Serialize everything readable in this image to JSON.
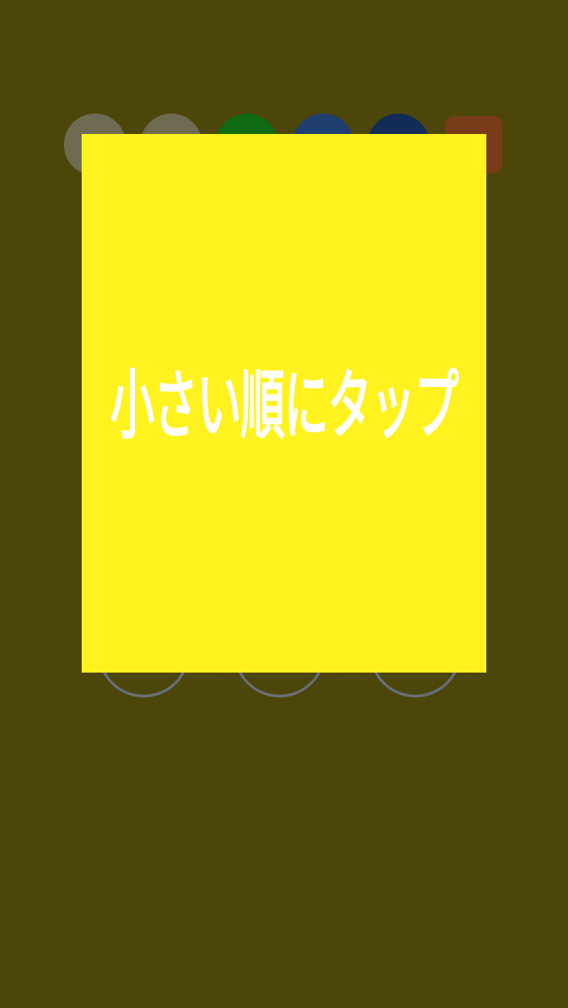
{
  "overlay": {
    "instruction": "小さい順にタップ"
  },
  "colors": {
    "background": "#4c460b",
    "overlay": "#fff21e",
    "instruction_text": "#ffffff",
    "circle_border": "#6b6e78"
  },
  "share_icons": [
    {
      "name": "mail-icon",
      "color": "#6e6b52"
    },
    {
      "name": "contact-icon",
      "color": "#6e6b52"
    },
    {
      "name": "line-icon",
      "color": "#0f6a12"
    },
    {
      "name": "facebook-icon",
      "color": "#1f3f6e"
    },
    {
      "name": "twitter-icon",
      "color": "#132c57"
    },
    {
      "name": "app-icon",
      "color": "#7a3b18"
    }
  ],
  "game_buttons": [
    {
      "name": "game-circle-1"
    },
    {
      "name": "game-circle-2"
    },
    {
      "name": "game-circle-3"
    }
  ]
}
